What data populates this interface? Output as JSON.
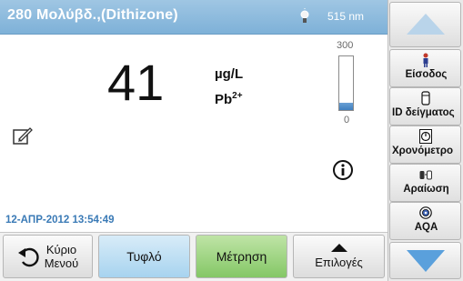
{
  "header": {
    "title": "280 Μολύβδ.,(Dithizone)",
    "wavelength": "515 nm",
    "lamp_icon": "lamp-icon"
  },
  "reading": {
    "value": "41",
    "unit": "µg/L",
    "species_base": "Pb",
    "species_charge": "2+"
  },
  "scale": {
    "max": "300",
    "min": "0",
    "fill_fraction": 0.137
  },
  "datetime": "12-ΑΠΡ-2012  13:54:49",
  "icons": {
    "edit": "edit-note-icon",
    "info": "info-icon"
  },
  "bottom_buttons": {
    "main_menu_line1": "Κύριο",
    "main_menu_line2": "Μενού",
    "blank": "Τυφλό",
    "measure": "Μέτρηση",
    "options": "Επιλογές"
  },
  "sidebar": {
    "items": [
      {
        "label": "Είσοδος",
        "icon": "user-icon"
      },
      {
        "label": "ID δείγματος",
        "icon": "sample-vial-icon"
      },
      {
        "label": "Χρονόμετρο",
        "icon": "timer-icon"
      },
      {
        "label": "Αραίωση",
        "icon": "dilution-icon"
      },
      {
        "label": "AQA",
        "icon": "aqa-icon"
      }
    ]
  },
  "colors": {
    "header": "#7eb1d8",
    "blank_button": "#a7d3ef",
    "measure_button": "#84c766",
    "datetime_text": "#3a7ab6",
    "scroll_down_arrow": "#5aa0dc"
  }
}
